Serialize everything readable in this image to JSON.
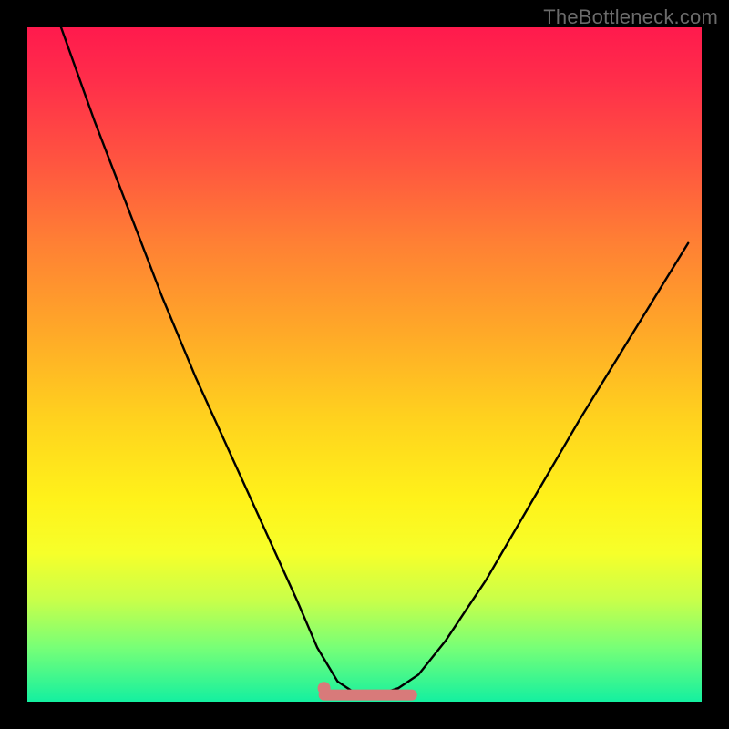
{
  "watermark": "TheBottleneck.com",
  "chart_data": {
    "type": "line",
    "title": "",
    "xlabel": "",
    "ylabel": "",
    "xlim": [
      0,
      100
    ],
    "ylim": [
      0,
      100
    ],
    "series": [
      {
        "name": "bottleneck-curve",
        "x": [
          5,
          10,
          15,
          20,
          25,
          30,
          35,
          40,
          43,
          46,
          49,
          52,
          55,
          58,
          62,
          68,
          75,
          82,
          90,
          98
        ],
        "y": [
          100,
          86,
          73,
          60,
          48,
          37,
          26,
          15,
          8,
          3,
          1,
          1,
          2,
          4,
          9,
          18,
          30,
          42,
          55,
          68
        ]
      }
    ],
    "annotations": [
      {
        "name": "flat-bottom-segment",
        "x_range": [
          44,
          57
        ],
        "y": 1
      },
      {
        "name": "marker-dot",
        "x": 44,
        "y": 2
      }
    ],
    "gradient_stops": [
      {
        "pct": 0,
        "color": "#ff1a4d"
      },
      {
        "pct": 50,
        "color": "#ffd21e"
      },
      {
        "pct": 80,
        "color": "#f6ff2a"
      },
      {
        "pct": 100,
        "color": "#14f0a0"
      }
    ]
  }
}
